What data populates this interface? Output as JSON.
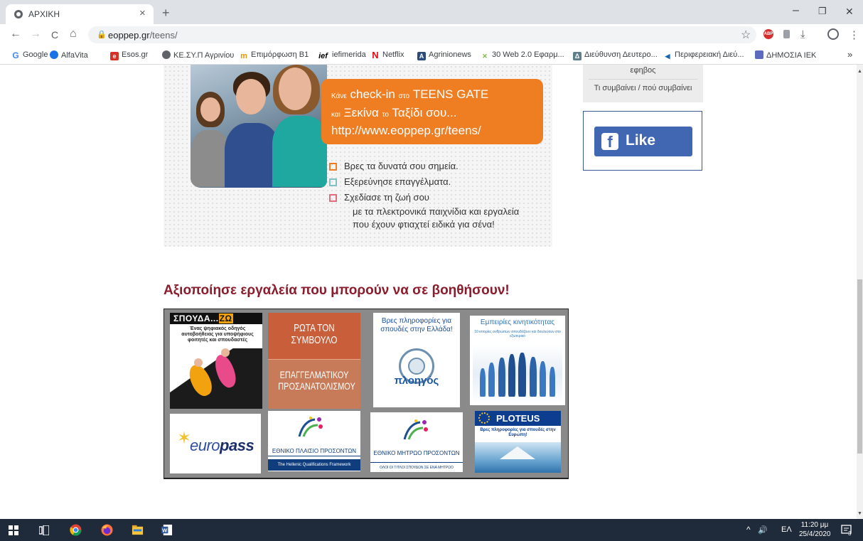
{
  "browser": {
    "tab_title": "ΑΡΧΙΚΗ",
    "tab_close": "×",
    "new_tab": "+",
    "minimize": "–",
    "restore": "❐",
    "close": "✕",
    "back": "←",
    "forward": "→",
    "reload": "C",
    "home": "⌂",
    "url_host": "eoppep.gr",
    "url_path": "/teens/",
    "star": "☆",
    "download": "⤓",
    "menu": "⋮",
    "abp_label": "ABP"
  },
  "bookmarks": [
    {
      "label": "Google",
      "icon": "google-icon",
      "badge": "G",
      "color": "#4285f4"
    },
    {
      "label": "AlfaVita",
      "icon": "globe-icon",
      "badge": "",
      "color": "#1a73e8"
    },
    {
      "label": "Esos.gr",
      "icon": "esos-icon",
      "badge": "e",
      "color": "#d93025"
    },
    {
      "label": "ΚΕ.ΣΥ.Π Αγρινίου",
      "icon": "globe-icon",
      "badge": "",
      "color": "#5f6368"
    },
    {
      "label": "Επιμόρφωση Β1",
      "icon": "training-icon",
      "badge": "m",
      "color": "#e69500"
    },
    {
      "label": "iefimerida",
      "icon": "iefimerida-icon",
      "badge": "ief",
      "color": "#000000"
    },
    {
      "label": "Netflix",
      "icon": "netflix-icon",
      "badge": "N",
      "color": "#e50914"
    },
    {
      "label": "Agrinionews",
      "icon": "agrinionews-icon",
      "badge": "A",
      "color": "#2b4a7d"
    },
    {
      "label": "30 Web 2.0 Εφαρμ...",
      "icon": "web20-icon",
      "badge": "✕",
      "color": "#7cb342"
    },
    {
      "label": "Διεύθυνση Δευτερο...",
      "icon": "school-icon",
      "badge": "Δ",
      "color": "#607d8b"
    },
    {
      "label": "Περιφερειακή Διεύ...",
      "icon": "flag-icon",
      "badge": "",
      "color": "#1565c0"
    },
    {
      "label": "ΔΗΜΟΣΙΑ ΙΕΚ",
      "icon": "iek-icon",
      "badge": "",
      "color": "#5c6bc0"
    }
  ],
  "bookmarks_more": "»",
  "page": {
    "sidebar": {
      "item_partial": "εφηβος",
      "item_events": "Τι συμβαίνει / πού συμβαίνει",
      "fb_f": "f",
      "fb_like": "Like"
    },
    "banner": {
      "line1_small_a": "Κάνε",
      "line1_main": " check-in ",
      "line1_small_b": "στο",
      "line1_end": " TEENS GATE",
      "line2_small_a": "και",
      "line2_main": " Ξεκίνα ",
      "line2_small_b": "το",
      "line2_end": " Ταξίδι σου...",
      "line3": "http://www.eoppep.gr/teens/",
      "check1": "Βρες τα δυνατά σου σημεία.",
      "check2": "Εξερεύνησε επαγγέλματα.",
      "check3": "Σχεδίασε τη ζωή σου",
      "sub1": "με τα πλεκτρονικά παιχνίδια και εργαλεία",
      "sub2": "που έχουν φτιαχτεί ειδικά για σένα!",
      "check_colors": [
        "#ef7d22",
        "#7fc2c6",
        "#e26c7a"
      ]
    },
    "tools_title": "Αξιοποίησε εργαλεία που μπορούν να σε βοηθήσουν!",
    "tools": {
      "spoudazo_a": "ΣΠΟΥΔΑ...",
      "spoudazo_b": "ΖΩ",
      "spoudazo_desc": "Ένας ψηφιακός οδηγός αυτοβοήθειας για υποψήφιους φοιτητές και σπουδαστές",
      "rota_1": "ΡΩΤΑ ΤΟΝ ΣΥΜΒΟΥΛΟ",
      "rota_2": "ΕΠΑΓΓΕΛΜΑΤΙΚΟΥ ΠΡΟΣΑΝΑΤΟΛΙΣΜΟΥ",
      "plogos_text": "Βρες πληροφορίες για σπουδές στην Ελλάδα!",
      "plogos_logo": "πλοηγός",
      "mobility_title": "Εμπειρίες κινητικότητας",
      "mobility_sub": "10 ιστορίες ανθρώπων σπουδάζουν και δουλεύουν στο εξωτερικό",
      "europass_a": "euro",
      "europass_b": "pass",
      "nqf_title": "ΕΘΝΙΚΟ ΠΛΑΙΣΙΟ ΠΡΟΣΟΝΤΩΝ",
      "nqf_band": "The Hellenic Qualifications Framework",
      "register_title": "ΕΘΝΙΚΟ ΜΗΤΡΩΟ ΠΡΟΣΟΝΤΩΝ",
      "register_band": "ΟΛΟΙ ΟΙ ΤΙΤΛΟΙ ΣΠΟΥΔΩΝ ΣΕ ΕΝΑ ΜΗΤΡΩΟ",
      "ploteus_name": "PLOTEUS",
      "ploteus_sub": "Βρες πληροφορίες για σπουδές στην Ευρώπη!"
    }
  },
  "taskbar": {
    "tray_up": "^",
    "tray_volume": "🔊",
    "language": "ΕΛ",
    "time": "11:20 μμ",
    "date": "25/4/2020",
    "notifications": "3"
  }
}
